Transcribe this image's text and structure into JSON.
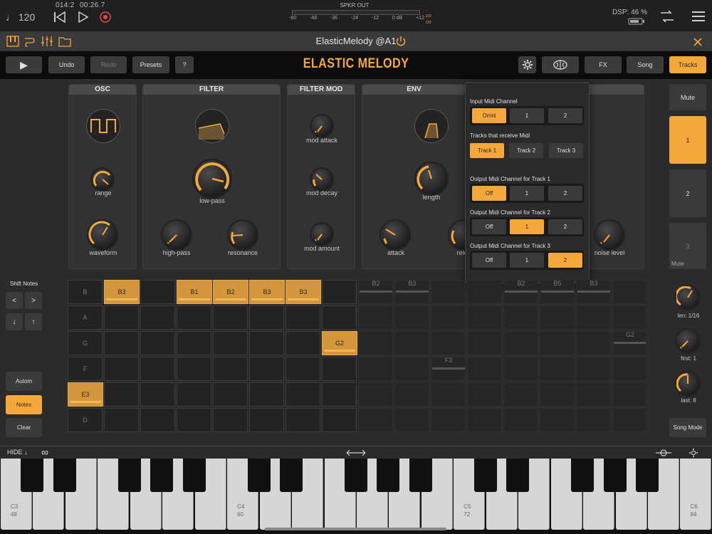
{
  "host": {
    "tempo": "♩ 120",
    "position": "014:2",
    "time": "00:26.7",
    "meter_label": "SPKR OUT",
    "meter_ticks": [
      "-60",
      "-48",
      "-36",
      "-24",
      "-12",
      "0 dB",
      "+12"
    ],
    "meter_inf": "-oo",
    "dsp": "DSP: 46 %"
  },
  "plugin_titlebar": {
    "title": "ElasticMelody @A1"
  },
  "toolbar": {
    "play": "▶",
    "undo": "Undo",
    "redo": "Redo",
    "presets": "Presets",
    "help": "?",
    "app_title": "ELASTIC MELODY",
    "fx": "FX",
    "song": "Song",
    "tracks": "Tracks"
  },
  "panels": {
    "osc": {
      "title": "OSC",
      "range": "range",
      "waveform": "waveform"
    },
    "filter": {
      "title": "FILTER",
      "lowpass": "low-pass",
      "highpass": "high-pass",
      "resonance": "resonance"
    },
    "filter_mod": {
      "title": "FILTER MOD",
      "attack": "mod attack",
      "decay": "mod decay",
      "amount": "mod amount"
    },
    "env": {
      "title": "ENV",
      "length": "length",
      "attack": "attack",
      "release": "rele"
    },
    "noise": {
      "label": "noise level"
    }
  },
  "tracks_side": {
    "mute": "Mute",
    "t1": "1",
    "t2": "2",
    "t3": "3",
    "mute_bottom": "Mute"
  },
  "midi_popup": {
    "input_channel": {
      "label": "Input Midi Channel",
      "options": [
        "Omni",
        "1",
        "2"
      ],
      "selected": 0
    },
    "tracks_receive": {
      "label": "Tracks that receive Midi",
      "options": [
        "Track 1",
        "Track 2",
        "Track 3"
      ],
      "selected": 0
    },
    "out_t1": {
      "label": "Output Midi Channel for Track 1",
      "options": [
        "Off",
        "1",
        "2"
      ],
      "selected": 0
    },
    "out_t2": {
      "label": "Output Midi Channel for Track 2",
      "options": [
        "Off",
        "1",
        "2"
      ],
      "selected": 1
    },
    "out_t3": {
      "label": "Output Midi Channel for Track 3",
      "options": [
        "Off",
        "1",
        "2"
      ],
      "selected": 2
    }
  },
  "left_controls": {
    "shift_notes": "Shift Notes",
    "left": "<",
    "right": ">",
    "down": "↓",
    "up": "↑",
    "autom": "Autom",
    "notes": "Notes",
    "clear": "Clear"
  },
  "grid": {
    "rows": [
      "B",
      "A",
      "G",
      "F",
      "E",
      "D"
    ],
    "notes": [
      {
        "label": "B3",
        "col": 1,
        "row": 0
      },
      {
        "label": "B1",
        "col": 3,
        "row": 0
      },
      {
        "label": "B2",
        "col": 4,
        "row": 0
      },
      {
        "label": "B3",
        "col": 5,
        "row": 0
      },
      {
        "label": "B3",
        "col": 6,
        "row": 0
      },
      {
        "label": "G2",
        "col": 7,
        "row": 2
      },
      {
        "label": "E3",
        "col": 0,
        "row": 4
      }
    ],
    "ghost_notes": [
      {
        "label": "B2",
        "col": 8,
        "row": 0
      },
      {
        "label": "B3",
        "col": 9,
        "row": 0
      },
      {
        "label": "B2",
        "col": 12,
        "row": 0
      },
      {
        "label": "B5",
        "col": 13,
        "row": 0
      },
      {
        "label": "B3",
        "col": 14,
        "row": 0
      },
      {
        "label": "G2",
        "col": 15,
        "row": 2
      },
      {
        "label": "F3",
        "col": 10,
        "row": 3
      }
    ]
  },
  "right_knobs": {
    "len": "len: 1/16",
    "first": "first: 1",
    "last": "last: 8",
    "song_mode": "Song Mode"
  },
  "keyboard_bar": {
    "hide": "HIDE ↓",
    "loop_icon": "∞"
  },
  "keyboard": {
    "labels": [
      {
        "note": "C3",
        "num": "48",
        "white_index": 0
      },
      {
        "note": "C4",
        "num": "60",
        "white_index": 7
      },
      {
        "note": "C5",
        "num": "72",
        "white_index": 14
      },
      {
        "note": "C6",
        "num": "84",
        "white_index": 21
      }
    ]
  },
  "colors": {
    "accent": "#f4a73a",
    "bg": "#2b2b2d"
  }
}
